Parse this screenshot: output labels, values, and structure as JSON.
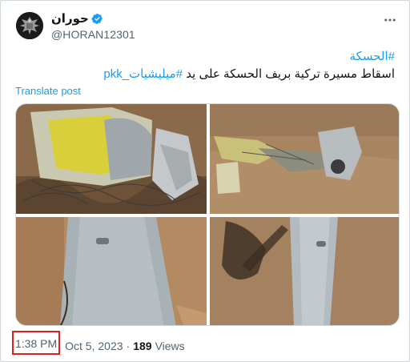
{
  "tweet": {
    "display_name": "حوران",
    "handle": "@HORAN12301",
    "verified_icon": "verified-badge-icon",
    "more_icon": "more-options-icon",
    "hashtag_line": "#الحسكة",
    "text_main": "اسقاط مسيرة تركية بريف الحسكة على يد",
    "text_tag": "#ميليشيات_pkk",
    "translate_label": "Translate post",
    "time": "1:38 PM",
    "separator": "·",
    "date": "Oct 5, 2023",
    "views_count": "189",
    "views_label": "Views"
  },
  "media": {
    "photos": [
      {
        "name": "photo-drone-wreckage-yellow"
      },
      {
        "name": "photo-drone-debris-field"
      },
      {
        "name": "photo-wing-panel-ground"
      },
      {
        "name": "photo-wing-with-shadow"
      }
    ]
  },
  "colors": {
    "link": "#1d9bf0",
    "secondary_text": "#536471",
    "highlight_box": "#e0201c",
    "border": "#cfd9de"
  }
}
